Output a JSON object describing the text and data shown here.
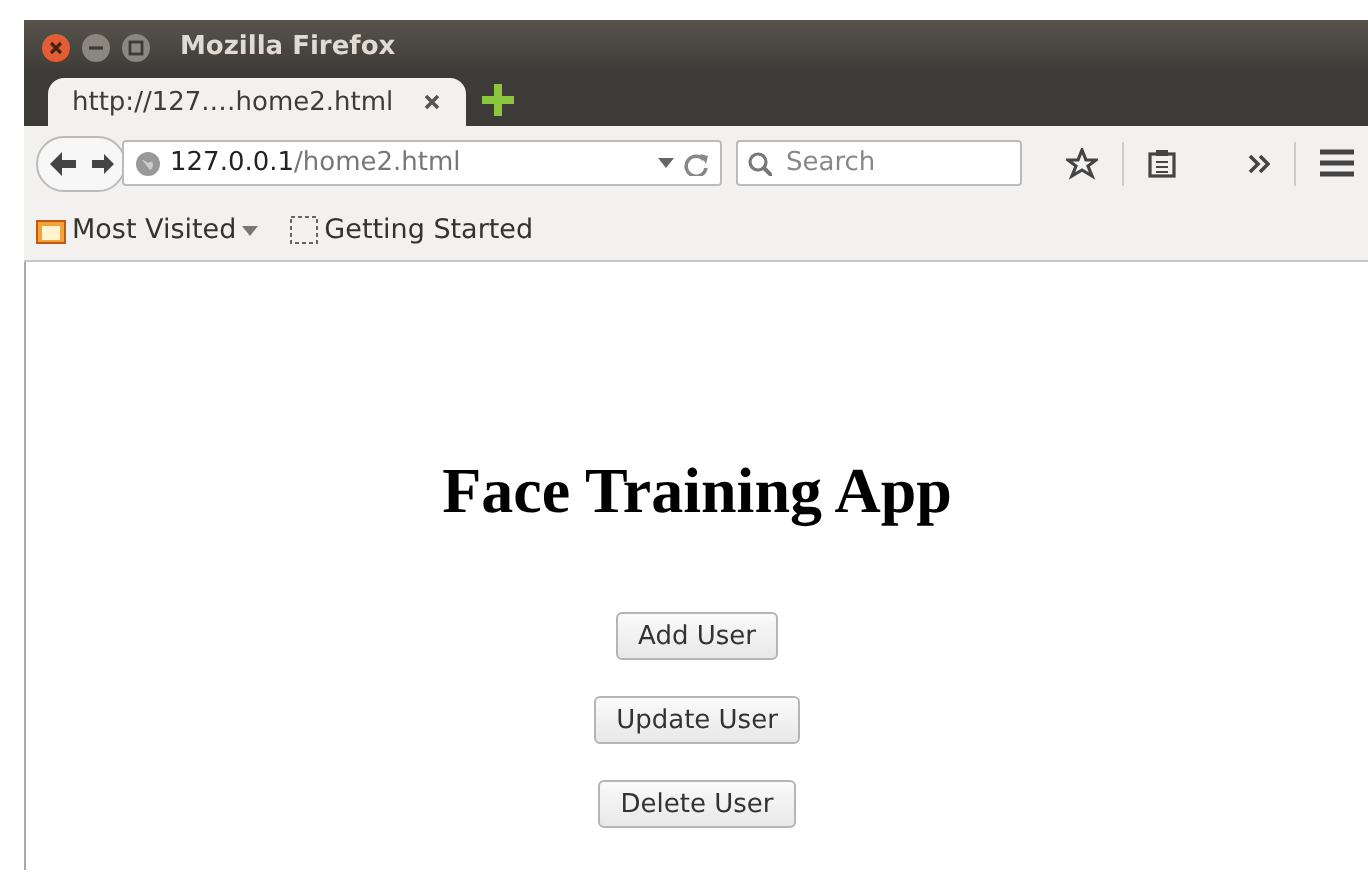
{
  "window": {
    "title": "Mozilla Firefox"
  },
  "tabs": [
    {
      "label": "http://127.…home2.html",
      "selected": true
    }
  ],
  "url": {
    "host": "127.0.0.1",
    "path": "/home2.html"
  },
  "search": {
    "placeholder": "Search"
  },
  "bookmarks": [
    {
      "label": "Most Visited",
      "kind": "folder"
    },
    {
      "label": "Getting Started",
      "kind": "page"
    }
  ],
  "page": {
    "heading": "Face Training App",
    "buttons": [
      "Add User",
      "Update User",
      "Delete User"
    ]
  }
}
